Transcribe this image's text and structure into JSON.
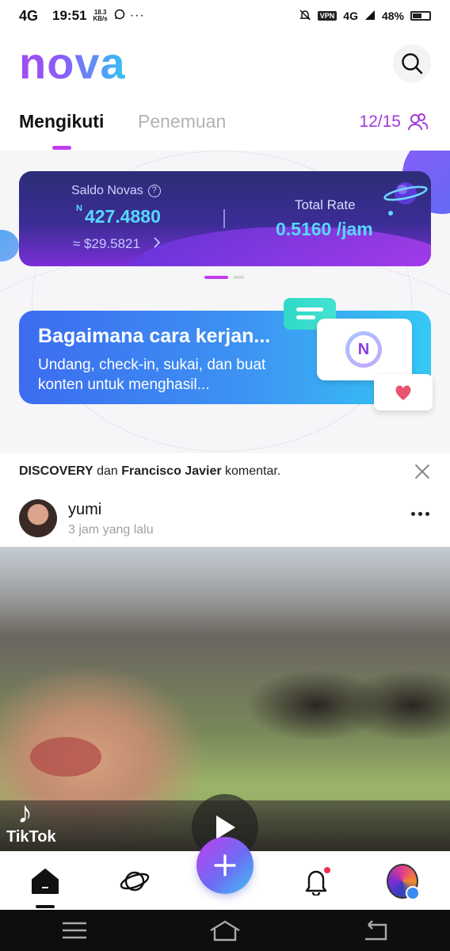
{
  "status_bar": {
    "network": "4G",
    "time": "19:51",
    "speed_value": "18.3",
    "speed_unit": "KB/s",
    "more": "···",
    "vpn": "VPN",
    "net2": "4G",
    "battery": "48%"
  },
  "header": {
    "logo": "nova",
    "search_icon": "search-icon"
  },
  "tabs": {
    "active": "Mengikuti",
    "inactive": "Penemuan",
    "follow_count": "12/15"
  },
  "balance_card": {
    "label": "Saldo Novas",
    "help": "?",
    "currency_symbol": "N",
    "value": "427.4880",
    "usd": "≈ $29.5821",
    "rate_label": "Total Rate",
    "rate_value": "0.5160 /jam"
  },
  "howto_card": {
    "title": "Bagaimana cara kerjan...",
    "description": "Undang, check-in, sukai, dan buat konten untuk menghasil...",
    "coin_letter": "N"
  },
  "notice": {
    "user1": "DISCOVERY",
    "connector": "dan",
    "user2": "Francisco Javier",
    "action": "komentar."
  },
  "post": {
    "username": "yumi",
    "time": "3 jam yang lalu",
    "watermark": "TikTok"
  },
  "colors": {
    "accent_purple": "#c13cf0",
    "accent_blue": "#35c2f2",
    "follow_purple": "#a23ad8"
  }
}
